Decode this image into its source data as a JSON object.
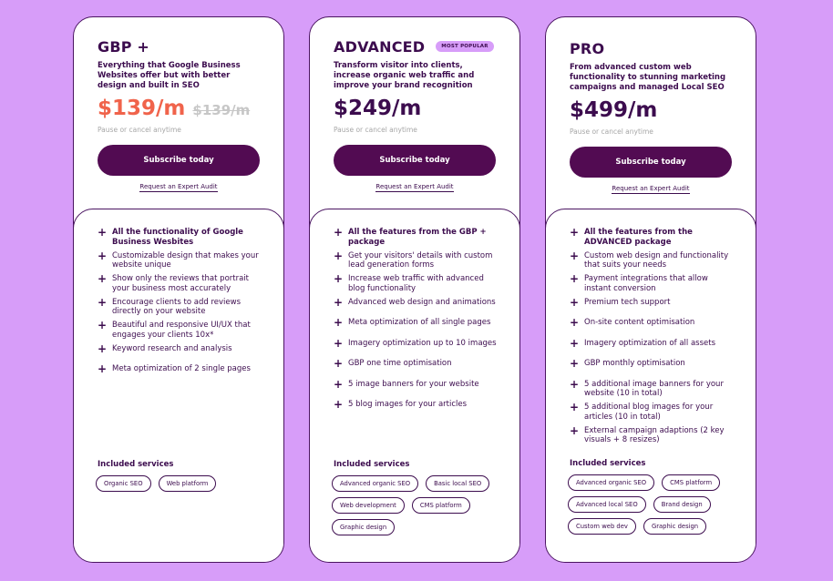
{
  "colors": {
    "background": "#d79df9",
    "primary": "#3c0c4e",
    "button": "#520b52",
    "sale_price": "#f0634b",
    "badge": "#d79df9"
  },
  "plans": [
    {
      "name": "GBP +",
      "badge": "",
      "description": "Everything that Google Business Websites offer but with better design and built in SEO",
      "price": "$139/m",
      "old_price": "$139/m",
      "cancel_note": "Pause or cancel anytime",
      "subscribe_label": "Subscribe today",
      "audit_label": "Request an Expert Audit",
      "features": [
        {
          "text": "All the functionality of Google Business Wesbites",
          "bold": true,
          "icon": "plus-icon"
        },
        {
          "text": "Customizable design that makes your website unique",
          "bold": false,
          "icon": "plus-icon"
        },
        {
          "text": "Show only the reviews that portrait your business most accurately",
          "bold": false,
          "icon": "plus-icon"
        },
        {
          "text": "Encourage clients to add reviews directly on your website",
          "bold": false,
          "icon": "plus-icon"
        },
        {
          "text": "Beautiful and responsive UI/UX that engages your clients 10x*",
          "bold": false,
          "icon": "plus-icon"
        },
        {
          "text": "Keyword research and analysis",
          "bold": false,
          "icon": "plus-icon"
        },
        {
          "text": "Meta optimization of 2 single pages",
          "bold": false,
          "icon": "plus-icon"
        }
      ],
      "services_title": "Included services",
      "services": [
        "Organic SEO",
        "Web platform"
      ]
    },
    {
      "name": "ADVANCED",
      "badge": "MOST POPULAR",
      "description": "Transform visitor into clients, increase organic web traffic and improve your brand recognition",
      "price": "$249/m",
      "old_price": "",
      "cancel_note": "Pause or cancel anytime",
      "subscribe_label": "Subscribe today",
      "audit_label": "Request an Expert Audit",
      "features": [
        {
          "text": "All the features from the GBP + package",
          "bold": true,
          "icon": "plus-icon"
        },
        {
          "text": "Get your visitors' details with custom lead generation forms",
          "bold": false,
          "icon": "plus-icon"
        },
        {
          "text": "Increase web traffic with advanced blog functionality",
          "bold": false,
          "icon": "plus-icon"
        },
        {
          "text": "Advanced web design and animations",
          "bold": false,
          "icon": "plus-icon"
        },
        {
          "text": "Meta optimization of all single pages",
          "bold": false,
          "icon": "plus-icon"
        },
        {
          "text": "Imagery optimization up to 10 images",
          "bold": false,
          "icon": "plus-icon"
        },
        {
          "text": "GBP one time optimisation",
          "bold": false,
          "icon": "plus-icon"
        },
        {
          "text": "5 image banners for your website",
          "bold": false,
          "icon": "plus-icon"
        },
        {
          "text": "5 blog images for your articles",
          "bold": false,
          "icon": "plus-icon"
        }
      ],
      "services_title": "Included services",
      "services": [
        "Advanced organic SEO",
        "Basic local SEO",
        "Web development",
        "CMS platform",
        "Graphic design"
      ]
    },
    {
      "name": "PRO",
      "badge": "",
      "description": "From advanced custom web functionality to stunning marketing campaigns and managed Local SEO",
      "price": "$499/m",
      "old_price": "",
      "cancel_note": "Pause or cancel anytime",
      "subscribe_label": "Subscribe today",
      "audit_label": "Request an Expert Audit",
      "features": [
        {
          "text": "All the features from the ADVANCED package",
          "bold": true,
          "icon": "plus-icon"
        },
        {
          "text": "Custom web design and functionality that suits your needs",
          "bold": false,
          "icon": "plus-icon"
        },
        {
          "text": "Payment integrations that allow instant conversion",
          "bold": false,
          "icon": "plus-icon"
        },
        {
          "text": "Premium tech support",
          "bold": false,
          "icon": "plus-icon"
        },
        {
          "text": "On-site content optimisation",
          "bold": false,
          "icon": "plus-icon"
        },
        {
          "text": "Imagery optimization of all assets",
          "bold": false,
          "icon": "plus-icon"
        },
        {
          "text": "GBP monthly optimisation",
          "bold": false,
          "icon": "plus-icon"
        },
        {
          "text": "5 additional image banners for your website (10 in total)",
          "bold": false,
          "icon": "plus-icon"
        },
        {
          "text": "5 additional blog images for your articles (10 in total)",
          "bold": false,
          "icon": "plus-icon"
        },
        {
          "text": "External campaign adaptions (2 key visuals + 8 resizes)",
          "bold": false,
          "icon": "plus-icon"
        }
      ],
      "services_title": "Included services",
      "services": [
        "Advanced organic SEO",
        "CMS platform",
        "Advanced local SEO",
        "Brand design",
        "Custom web dev",
        "Graphic design"
      ]
    }
  ]
}
